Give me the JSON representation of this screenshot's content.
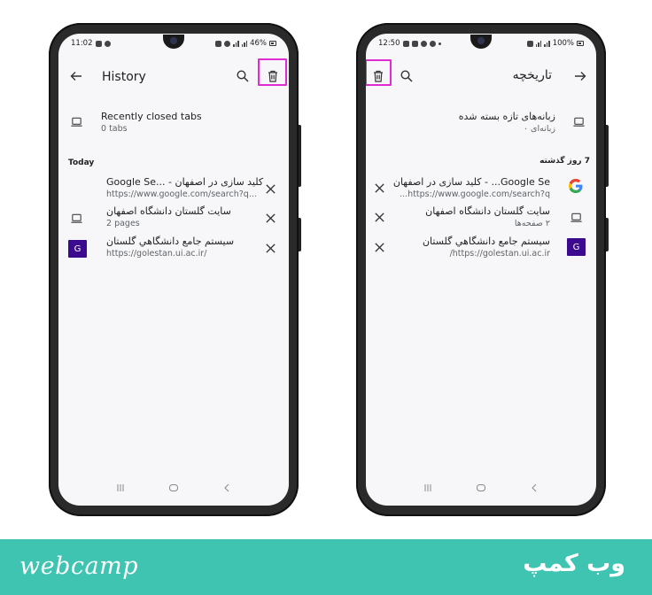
{
  "left_phone": {
    "status": {
      "time": "11:02",
      "battery": "46%"
    },
    "title": "History",
    "recent": {
      "title": "Recently closed tabs",
      "sub": "0 tabs"
    },
    "section": "Today",
    "items": [
      {
        "title": "Google Se... - کلید سازی در اصفهان",
        "sub": "https://www.google.com/search?q..."
      },
      {
        "title": "سایت گلستان دانشگاه اصفهان",
        "sub": "2 pages"
      },
      {
        "title": "سیستم جامع دانشگاهي گلستان",
        "sub": "https://golestan.ui.ac.ir/",
        "badge": "G"
      }
    ]
  },
  "right_phone": {
    "status": {
      "time": "12:50",
      "battery": "100%"
    },
    "title": "تاریخچه",
    "recent": {
      "title": "زبانه‌های تازه بسته شده",
      "sub": "زبانه‌ای ۰"
    },
    "section": "7 روز گذشته",
    "items": [
      {
        "title": "Google Se... - کلید سازی در اصفهان",
        "sub": "https://www.google.com/search?q..."
      },
      {
        "title": "سایت گلستان دانشگاه اصفهان",
        "sub": "۲ صفحه‌ها"
      },
      {
        "title": "سیستم جامع دانشگاهي گلستان",
        "sub": "https://golestan.ui.ac.ir/",
        "badge": "G"
      }
    ]
  },
  "footer": {
    "brand_en": "webcamp",
    "brand_fa": "وب کمپ"
  },
  "colors": {
    "highlight": "#e02bd2",
    "footer_bg": "#3fc4b2",
    "favicon_bg": "#3c0a8e"
  }
}
